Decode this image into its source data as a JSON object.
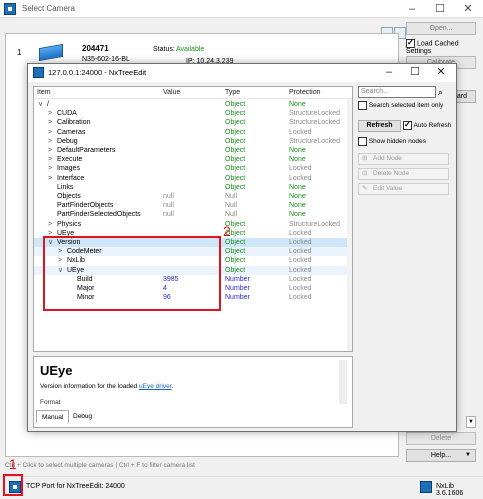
{
  "background_window": {
    "title": "Select Camera",
    "caption_buttons": [
      "–",
      "☐",
      "✕"
    ],
    "camera": {
      "index": "1",
      "serial": "204471",
      "model": "N35-602-16-BL",
      "status_label": "Status:",
      "status_value": "Available",
      "ip": "IP: 10.24.3.239"
    },
    "buttons": {
      "open": "Open...",
      "calibrate": "Calibrate",
      "board": "ard",
      "delete": "Delete",
      "help": "Help..."
    },
    "load_cached_settings": "Load Cached Settings",
    "hint": "Ctrl + Click to select multiple cameras | Ctrl + F to filter camera list",
    "status_text": "TCP Port for NxTreeEdit:  24000",
    "version": "NxLib 3.6.1606"
  },
  "nx_window": {
    "title": "127.0.0.1:24000 - NxTreeEdit",
    "caption_buttons": [
      "–",
      "☐",
      "✕"
    ],
    "columns": [
      "Item",
      "Value",
      "Type",
      "Protection"
    ],
    "rows": [
      {
        "arrow": "∨",
        "name": "/",
        "value": "",
        "type": "Object",
        "protection": "None",
        "depth": 0
      },
      {
        "arrow": ">",
        "name": "CUDA",
        "value": "",
        "type": "Object",
        "protection": "StructureLocked",
        "depth": 1
      },
      {
        "arrow": ">",
        "name": "Calibration",
        "value": "",
        "type": "Object",
        "protection": "StructureLocked",
        "depth": 1
      },
      {
        "arrow": ">",
        "name": "Cameras",
        "value": "",
        "type": "Object",
        "protection": "Locked",
        "depth": 1
      },
      {
        "arrow": ">",
        "name": "Debug",
        "value": "",
        "type": "Object",
        "protection": "StructureLocked",
        "depth": 1
      },
      {
        "arrow": ">",
        "name": "DefaultParameters",
        "value": "",
        "type": "Object",
        "protection": "None",
        "depth": 1
      },
      {
        "arrow": ">",
        "name": "Execute",
        "value": "",
        "type": "Object",
        "protection": "None",
        "depth": 1
      },
      {
        "arrow": ">",
        "name": "Images",
        "value": "",
        "type": "Object",
        "protection": "Locked",
        "depth": 1
      },
      {
        "arrow": ">",
        "name": "Interface",
        "value": "",
        "type": "Object",
        "protection": "Locked",
        "depth": 1
      },
      {
        "arrow": "",
        "name": "Links",
        "value": "",
        "type": "Object",
        "protection": "None",
        "depth": 1
      },
      {
        "arrow": "",
        "name": "Objects",
        "value": "null",
        "type": "Null",
        "protection": "None",
        "depth": 1
      },
      {
        "arrow": "",
        "name": "PartFinderObjects",
        "value": "null",
        "type": "Null",
        "protection": "None",
        "depth": 1
      },
      {
        "arrow": "",
        "name": "PartFinderSelectedObjects",
        "value": "null",
        "type": "Null",
        "protection": "None",
        "depth": 1
      },
      {
        "arrow": ">",
        "name": "Physics",
        "value": "",
        "type": "Object",
        "protection": "StructureLocked",
        "depth": 1
      },
      {
        "arrow": ">",
        "name": "UEye",
        "value": "",
        "type": "Object",
        "protection": "Locked",
        "depth": 1
      },
      {
        "arrow": "∨",
        "name": "Version",
        "value": "",
        "type": "Object",
        "protection": "Locked",
        "depth": 1
      },
      {
        "arrow": ">",
        "name": "CodeMeter",
        "value": "",
        "type": "Object",
        "protection": "Locked",
        "depth": 2
      },
      {
        "arrow": ">",
        "name": "NxLib",
        "value": "",
        "type": "Object",
        "protection": "Locked",
        "depth": 2
      },
      {
        "arrow": "∨",
        "name": "UEye",
        "value": "",
        "type": "Object",
        "protection": "Locked",
        "depth": 2
      },
      {
        "arrow": "",
        "name": "Build",
        "value": "3985",
        "type": "Number",
        "protection": "Locked",
        "depth": 3
      },
      {
        "arrow": "",
        "name": "Major",
        "value": "4",
        "type": "Number",
        "protection": "Locked",
        "depth": 3
      },
      {
        "arrow": "",
        "name": "Minor",
        "value": "96",
        "type": "Number",
        "protection": "Locked",
        "depth": 3
      }
    ],
    "search_placeholder": "Search...",
    "search_selected_only": "Search selected item only",
    "refresh": "Refresh",
    "auto_refresh": "Auto Refresh",
    "show_hidden_nodes": "Show hidden nodes",
    "add_node": "Add Node",
    "delete_node": "Delete Node",
    "edit_value": "Edit Value",
    "doc_title": "UEye",
    "doc_text_prefix": "Version information for the loaded ",
    "doc_link": "uEye driver",
    "doc_text_suffix": ".",
    "doc_format": "Format",
    "tabs": [
      "Manual",
      "Debug"
    ]
  },
  "annotations": {
    "label_1": "1",
    "label_2": "2",
    "color": "#e0141e"
  }
}
